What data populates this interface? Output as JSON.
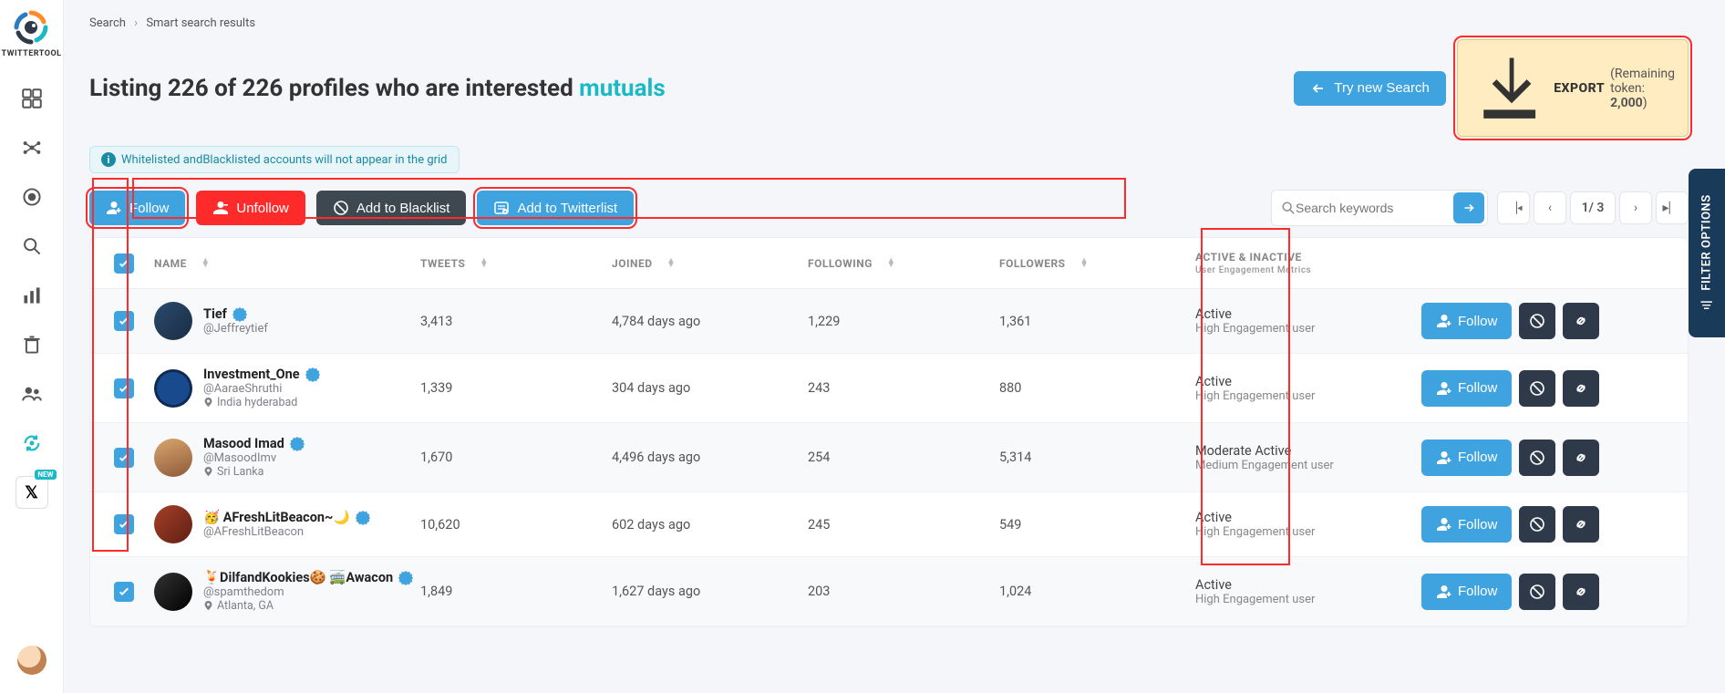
{
  "brand": "TWITTERTOOL",
  "breadcrumb": {
    "a": "Search",
    "b": "Smart search results"
  },
  "title": {
    "prefix": "Listing 226 of 226 profiles who are interested ",
    "keyword": "mutuals"
  },
  "note": "Whitelisted andBlacklisted accounts will not appear in the grid",
  "buttons": {
    "try_search": "Try new Search",
    "export": "EXPORT",
    "export_remaining_label": "(Remaining token: ",
    "export_token": "2,000",
    "export_remaining_close": ")",
    "follow": "Follow",
    "unfollow": "Unfollow",
    "blacklist": "Add to Blacklist",
    "twitterlist": "Add to Twitterlist"
  },
  "search": {
    "placeholder": "Search keywords"
  },
  "pager": {
    "page": "1",
    "sep": "/",
    "total": "3"
  },
  "columns": {
    "name": "NAME",
    "tweets": "TWEETS",
    "joined": "JOINED",
    "following": "FOLLOWING",
    "followers": "FOLLOWERS",
    "active": "ACTIVE & INACTIVE",
    "active_sub": "User Engagement Metrics"
  },
  "row_labels": {
    "follow": "Follow"
  },
  "filter_tab": "FILTER OPTIONS",
  "nav_new_badge": "NEW",
  "rows": [
    {
      "name": "Tief",
      "handle": "@Jeffreytief",
      "location": "",
      "tweets": "3,413",
      "joined": "4,784 days ago",
      "following": "1,229",
      "followers": "1,361",
      "active": "Active",
      "engagement": "High Engagement user",
      "avatar": "av1"
    },
    {
      "name": "Investment_One",
      "handle": "@AaraeShruthi",
      "location": "India hyderabad",
      "tweets": "1,339",
      "joined": "304 days ago",
      "following": "243",
      "followers": "880",
      "active": "Active",
      "engagement": "High Engagement user",
      "avatar": "av2"
    },
    {
      "name": "Masood Imad",
      "handle": "@MasoodImv",
      "location": "Sri Lanka",
      "tweets": "1,670",
      "joined": "4,496 days ago",
      "following": "254",
      "followers": "5,314",
      "active": "Moderate Active",
      "engagement": "Medium Engagement user",
      "avatar": "av3"
    },
    {
      "name": "🥳 AFreshLitBeacon~🌙",
      "handle": "@AFreshLitBeacon",
      "location": "",
      "tweets": "10,620",
      "joined": "602 days ago",
      "following": "245",
      "followers": "549",
      "active": "Active",
      "engagement": "High Engagement user",
      "avatar": "av4"
    },
    {
      "name": "🍹DilfandKookies🍪 🚎Awacon",
      "handle": "@spamthedom",
      "location": "Atlanta, GA",
      "tweets": "1,849",
      "joined": "1,627 days ago",
      "following": "203",
      "followers": "1,024",
      "active": "Active",
      "engagement": "High Engagement user",
      "avatar": "av5"
    }
  ]
}
